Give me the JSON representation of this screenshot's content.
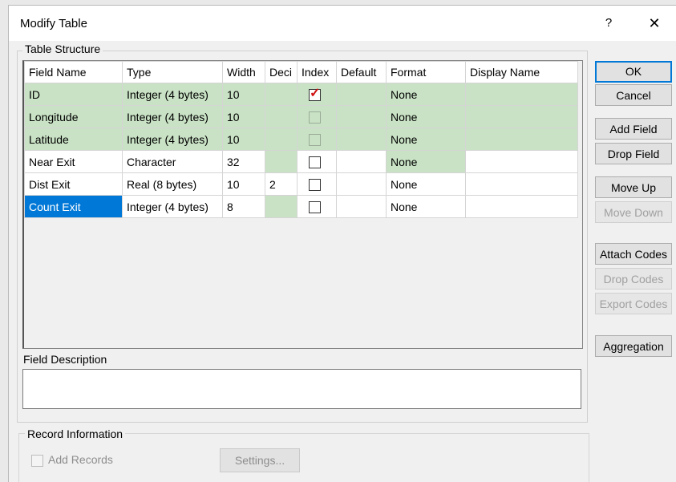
{
  "window": {
    "title": "Modify Table",
    "help": "?",
    "close": "✕"
  },
  "table_structure": {
    "label": "Table Structure",
    "columns": [
      "Field Name",
      "Type",
      "Width",
      "Deci",
      "Index",
      "Default",
      "Format",
      "Display Name"
    ],
    "rows": [
      {
        "name": "ID",
        "type": "Integer (4 bytes)",
        "width": "10",
        "deci": "",
        "index": true,
        "default": "",
        "format": "None",
        "display": ""
      },
      {
        "name": "Longitude",
        "type": "Integer (4 bytes)",
        "width": "10",
        "deci": "",
        "index": false,
        "default": "",
        "format": "None",
        "display": ""
      },
      {
        "name": "Latitude",
        "type": "Integer (4 bytes)",
        "width": "10",
        "deci": "",
        "index": false,
        "default": "",
        "format": "None",
        "display": ""
      },
      {
        "name": "Near Exit",
        "type": "Character",
        "width": "32",
        "deci": "",
        "index": false,
        "default": "",
        "format": "None",
        "display": ""
      },
      {
        "name": "Dist Exit",
        "type": "Real (8 bytes)",
        "width": "10",
        "deci": "2",
        "index": false,
        "default": "",
        "format": "None",
        "display": ""
      },
      {
        "name": "Count Exit",
        "type": "Integer (4 bytes)",
        "width": "8",
        "deci": "",
        "index": false,
        "default": "",
        "format": "None",
        "display": ""
      }
    ]
  },
  "field_description": {
    "label": "Field Description",
    "value": ""
  },
  "record_information": {
    "label": "Record Information",
    "add_records": "Add Records",
    "settings": "Settings..."
  },
  "buttons": {
    "ok": "OK",
    "cancel": "Cancel",
    "add_field": "Add Field",
    "drop_field": "Drop Field",
    "move_up": "Move Up",
    "move_down": "Move Down",
    "attach_codes": "Attach Codes",
    "drop_codes": "Drop Codes",
    "export_codes": "Export Codes",
    "aggregation": "Aggregation"
  },
  "colors": {
    "locked_row": "#c9e2c5",
    "selection": "#0078d7",
    "check_mark": "#d01010"
  }
}
